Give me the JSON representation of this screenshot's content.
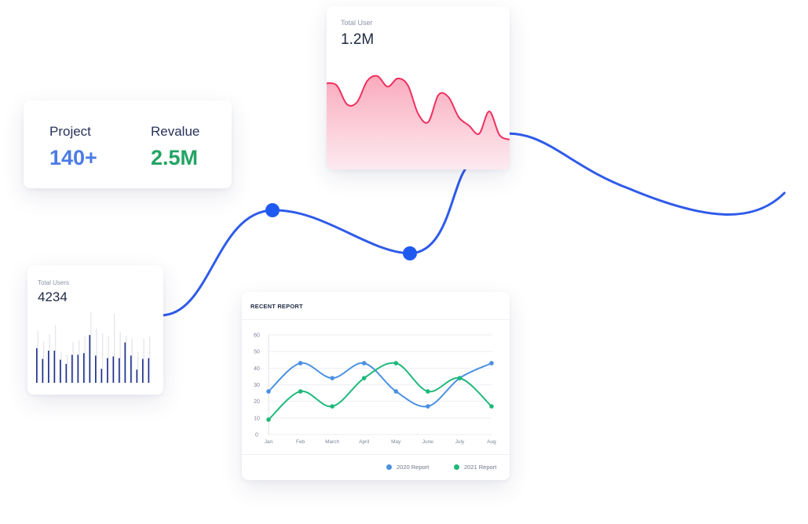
{
  "stats": {
    "project_label": "Project",
    "project_value": "140+",
    "revalue_label": "Revalue",
    "revalue_value": "2.5M"
  },
  "total_user": {
    "label": "Total User",
    "value": "1.2M"
  },
  "total_users": {
    "label": "Total Users",
    "value": "4234"
  },
  "colors": {
    "blue": "#2f5bea",
    "project_blue": "#4b7be5",
    "revalue_green": "#22a463",
    "pink": "#f0305f",
    "navy": "#1c2f8f",
    "series_2020": "#4a90e2",
    "series_2021": "#1db97a"
  },
  "chart_data": [
    {
      "type": "line",
      "title": "RECENT REPORT",
      "categories": [
        "Jan",
        "Feb",
        "March",
        "April",
        "May",
        "June",
        "July",
        "Aug"
      ],
      "ylim": [
        0,
        60
      ],
      "yticks": [
        0,
        10,
        20,
        30,
        40,
        50,
        60
      ],
      "grid": true,
      "legend": "bottom-right",
      "series": [
        {
          "name": "2020 Report",
          "color": "#4a90e2",
          "values": [
            26,
            43,
            34,
            43,
            26,
            17,
            34,
            43
          ]
        },
        {
          "name": "2021 Report",
          "color": "#1db97a",
          "values": [
            9,
            26,
            17,
            34,
            43,
            26,
            34,
            17
          ]
        }
      ]
    },
    {
      "type": "area",
      "title": "Total User",
      "color": "#f0305f",
      "values": [
        38,
        36,
        20,
        22,
        40,
        44,
        35,
        42,
        36,
        12,
        5,
        28,
        26,
        9,
        2,
        -5,
        14,
        -6,
        -10
      ]
    },
    {
      "type": "bar",
      "title": "Total Users",
      "series": [
        {
          "name": "",
          "color": "#1c2f8f",
          "values": [
            42,
            29,
            39,
            39,
            28,
            23,
            34,
            34,
            36,
            58,
            33,
            17,
            30,
            32,
            30,
            49,
            33,
            16,
            29,
            30
          ]
        },
        {
          "name": "",
          "color": "#e4e6ec",
          "values": [
            63,
            50,
            59,
            70,
            38,
            34,
            50,
            52,
            57,
            86,
            66,
            60,
            57,
            84,
            62,
            57,
            54,
            38,
            54,
            56
          ]
        }
      ]
    }
  ]
}
